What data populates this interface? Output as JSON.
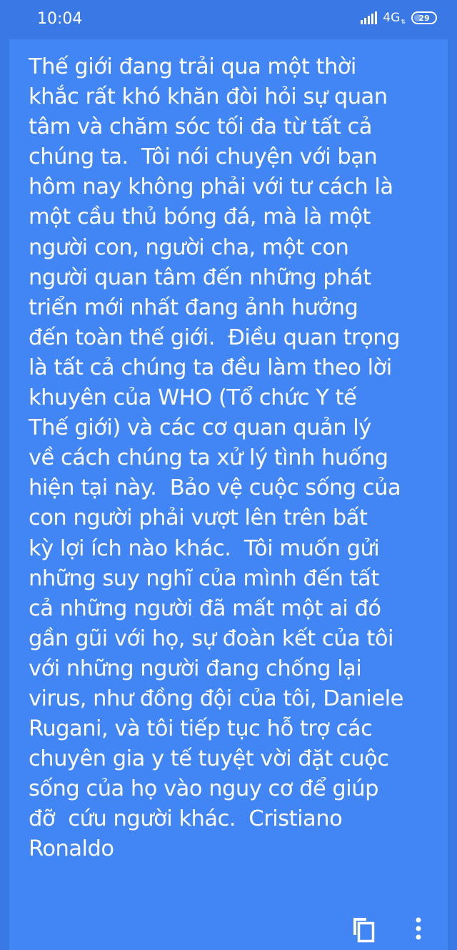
{
  "status_bar": {
    "time": "10:04",
    "signal_icon": "signal-bars-icon",
    "network": "4G",
    "battery_icon": "battery-icon",
    "battery_level": "29"
  },
  "note": {
    "lines": [
      "Thế giới đang trải qua một thời",
      "khắc rất khó khăn đòi hỏi sự quan",
      "tâm và chăm sóc tối đa từ tất cả",
      "chúng ta.  Tôi nói chuyện với bạn",
      "hôm nay không phải với tư cách là",
      "một cầu thủ bóng đá, mà là một",
      "người con, người cha, một con",
      "người quan tâm đến những phát",
      "triển mới nhất đang ảnh hưởng",
      "đến toàn thế giới.  Điều quan trọng",
      "là tất cả chúng ta đều làm theo lời",
      "khuyên của WHO (Tổ chức Y tế",
      "Thế giới) và các cơ quan quản lý",
      "về cách chúng ta xử lý tình huống",
      "hiện tại này.  Bảo vệ cuộc sống của",
      "con người phải vượt lên trên bất",
      "kỳ lợi ích nào khác.  Tôi muốn gửi",
      "những suy nghĩ của mình đến tất",
      "cả những người đã mất một ai đó",
      "gần gũi với họ, sự đoàn kết của tôi",
      "với những người đang chống lại",
      "virus, như đồng đội của tôi, Daniele",
      "Rugani, và tôi tiếp tục hỗ trợ các",
      "chuyên gia y tế tuyệt vời đặt cuộc",
      "sống của họ vào nguy cơ để giúp",
      "đỡ  cứu người khác.  Cristiano",
      "Ronaldo"
    ]
  },
  "actions": {
    "copy_icon": "copy-icon",
    "more_icon": "more-vertical-icon"
  },
  "colors": {
    "status_bar_bg": "#3a78e6",
    "note_bg": "#4285f4",
    "text": "#ffffff"
  }
}
